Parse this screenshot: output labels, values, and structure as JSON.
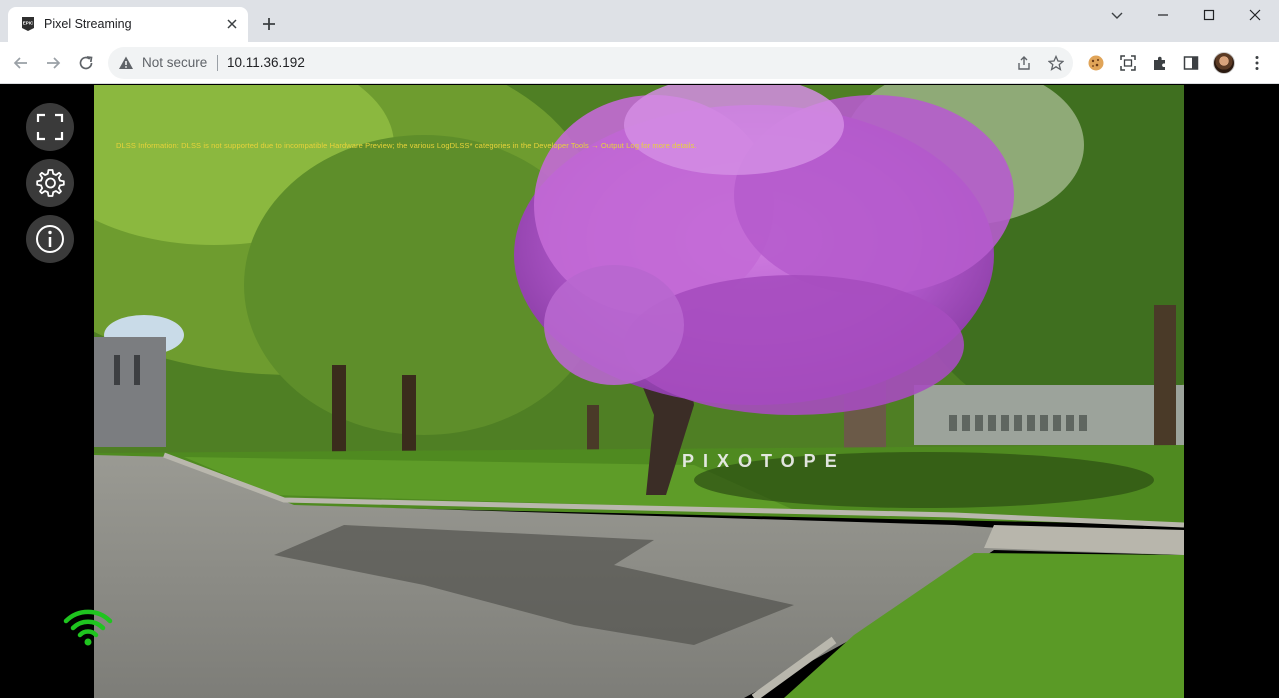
{
  "browser": {
    "tab_title": "Pixel Streaming",
    "not_secure_label": "Not secure",
    "url": "10.11.36.192"
  },
  "icons": {
    "favicon": "epic-games-icon",
    "tab_close": "close-icon",
    "new_tab": "plus-icon",
    "minimize": "minimize-icon",
    "maximize": "maximize-icon",
    "close": "close-icon",
    "back": "arrow-left-icon",
    "forward": "arrow-right-icon",
    "reload": "reload-icon",
    "warning": "warning-triangle-icon",
    "share": "share-icon",
    "bookmark": "star-icon",
    "cookie": "cookie-icon",
    "capture": "screen-capture-icon",
    "extensions": "puzzle-icon",
    "sidebar": "side-panel-icon",
    "menu": "kebab-menu-icon",
    "fullscreen": "fullscreen-icon",
    "settings": "gear-icon",
    "info": "info-icon",
    "connection": "wifi-icon"
  },
  "stream": {
    "dlss_message": "DLSS Information: DLSS is not supported due to incompatible Hardware Preview; the various LogDLSS* categories in the Developer Tools → Output Log for more details.",
    "watermark": "PIXOTOPE",
    "connection_color": "#1fc41f"
  }
}
